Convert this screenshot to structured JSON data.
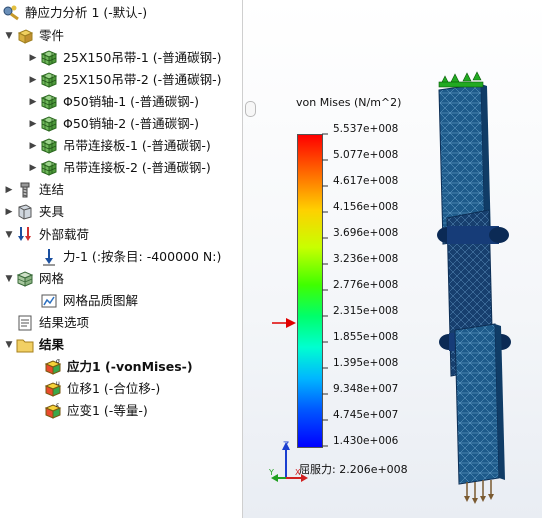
{
  "tree": {
    "root": "静应力分析 1 (-默认-)",
    "parts_header": "零件",
    "parts": [
      "25X150吊带-1 (-普通碳钢-)",
      "25X150吊带-2 (-普通碳钢-)",
      "Φ50销轴-1 (-普通碳钢-)",
      "Φ50销轴-2 (-普通碳钢-)",
      "吊带连接板-1 (-普通碳钢-)",
      "吊带连接板-2 (-普通碳钢-)"
    ],
    "connections": "连结",
    "fixtures": "夹具",
    "external_loads": "外部载荷",
    "force": "力-1 (:按条目: -400000 N:)",
    "mesh": "网格",
    "mesh_quality": "网格品质图解",
    "result_options": "结果选项",
    "results": "结果",
    "stress": "应力1 (-vonMises-)",
    "displacement": "位移1 (-合位移-)",
    "strain": "应变1 (-等量-)"
  },
  "legend": {
    "title": "von Mises (N/m^2)",
    "ticks": [
      "5.537e+008",
      "5.077e+008",
      "4.617e+008",
      "4.156e+008",
      "3.696e+008",
      "3.236e+008",
      "2.776e+008",
      "2.315e+008",
      "1.855e+008",
      "1.395e+008",
      "9.348e+007",
      "4.745e+007",
      "1.430e+006"
    ],
    "yield_label": "屈服力: 2.206e+008",
    "yield_marker": 220600000.0
  },
  "triad": {
    "z": "Z",
    "y": "Y",
    "x": "X"
  },
  "colors": {
    "mesh_dark": "#0f3c70",
    "mesh_mid": "#1d5a8a",
    "yield_arrow": "#e00000",
    "fixture": "#22aa22"
  }
}
